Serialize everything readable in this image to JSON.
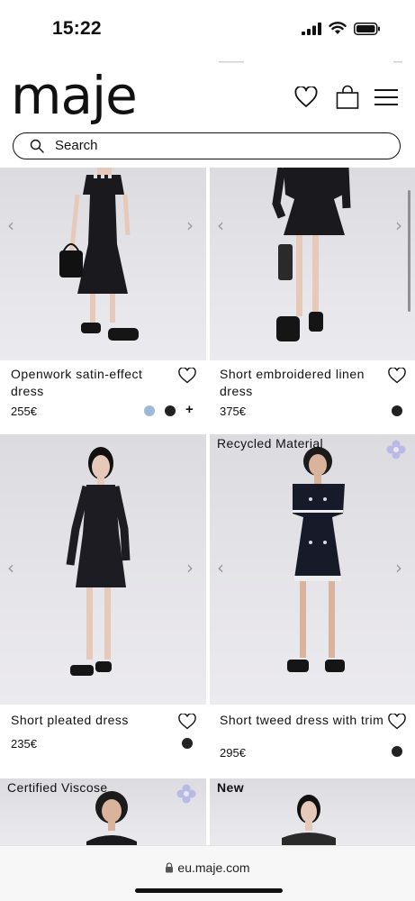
{
  "status_bar": {
    "time": "15:22"
  },
  "header": {
    "logo": "maje",
    "search_placeholder": "Search"
  },
  "products": [
    {
      "name": "Openwork satin-effect dress",
      "price": "255€",
      "tag": "",
      "colors": [
        "#9fb8d8",
        "#222222"
      ],
      "more_colors": "+"
    },
    {
      "name": "Short embroidered linen dress",
      "price": "375€",
      "tag": "",
      "colors": [
        "#222222"
      ],
      "more_colors": ""
    },
    {
      "name": "Short pleated dress",
      "price": "235€",
      "tag": "",
      "colors": [
        "#222222"
      ],
      "more_colors": ""
    },
    {
      "name": "Short tweed dress with trim",
      "price": "295€",
      "tag": "Recycled Material",
      "colors": [
        "#222222"
      ],
      "more_colors": ""
    },
    {
      "name": "",
      "price": "",
      "tag": "Certified Viscose",
      "colors": [],
      "more_colors": ""
    },
    {
      "name": "",
      "price": "",
      "tag": "New",
      "colors": [],
      "more_colors": ""
    }
  ],
  "browser": {
    "url": "eu.maje.com"
  },
  "icons": {
    "wishlist": "heart-icon",
    "cart": "bag-icon",
    "menu": "hamburger-icon",
    "search": "search-icon",
    "eco": "flower-icon",
    "lock": "lock-icon"
  },
  "colors": {
    "eco_badge": "#b9b9e6",
    "text": "#111111",
    "photo_bg": "#e3e2e7"
  }
}
